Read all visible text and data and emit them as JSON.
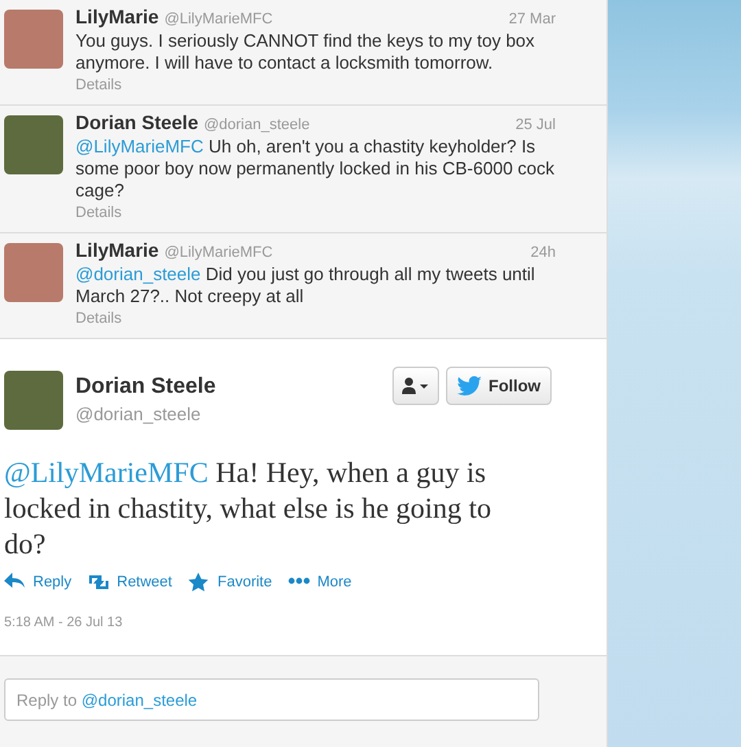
{
  "replies": [
    {
      "name": "LilyMarie",
      "handle": "@LilyMarieMFC",
      "time": "27 Mar",
      "text": "You guys. I seriously CANNOT find the keys to my toy box anymore. I will have to contact a locksmith tomorrow.",
      "details": "Details"
    },
    {
      "name": "Dorian Steele",
      "handle": "@dorian_steele",
      "time": "25 Jul",
      "mention": "@LilyMarieMFC",
      "text": "Uh oh, aren't you a chastity keyholder? Is some poor boy now permanently locked in his CB-6000 cock cage?",
      "details": "Details"
    },
    {
      "name": "LilyMarie",
      "handle": "@LilyMarieMFC",
      "time": "24h",
      "mention": "@dorian_steele",
      "text": "Did you just go through all my tweets until March 27?.. Not creepy at all",
      "details": "Details"
    }
  ],
  "tweet": {
    "name": "Dorian Steele",
    "handle": "@dorian_steele",
    "follow": "Follow",
    "mention": "@LilyMarieMFC",
    "text": "Ha! Hey, when a guy is locked in chastity, what else is he going to do?",
    "actions": [
      {
        "kind": "reply",
        "label": "Reply"
      },
      {
        "kind": "retweet",
        "label": "Retweet"
      },
      {
        "kind": "favorite",
        "label": "Favorite"
      },
      {
        "kind": "more",
        "label": "More"
      }
    ],
    "timestamp": "5:18 AM - 26 Jul 13"
  },
  "reply_box": {
    "prompt": "Reply to",
    "mention": "@dorian_steele"
  }
}
